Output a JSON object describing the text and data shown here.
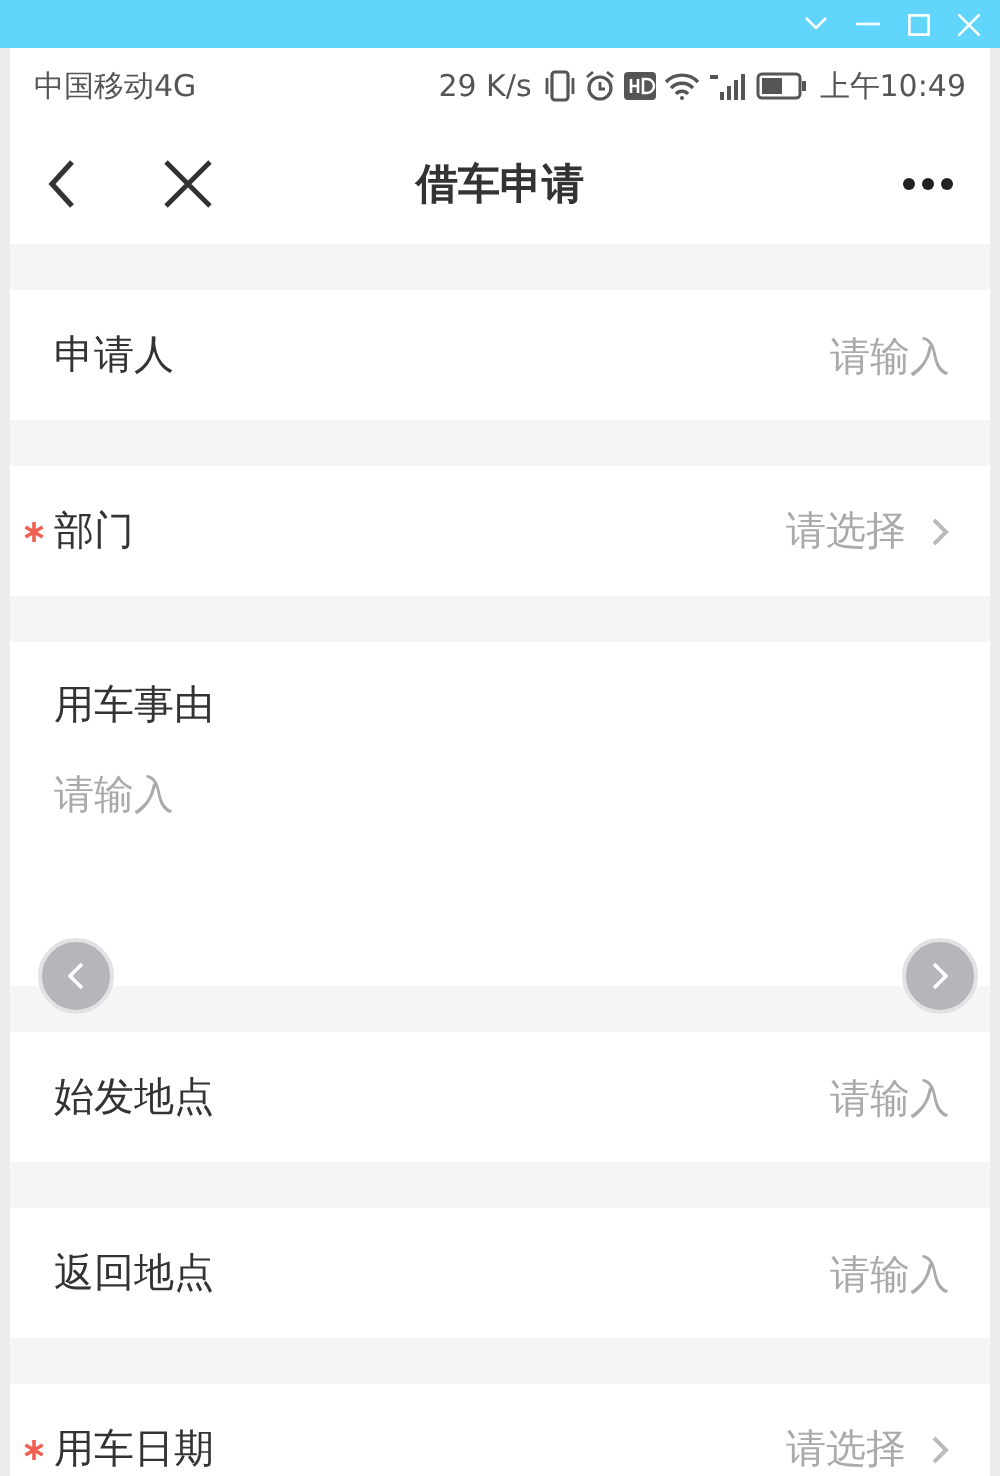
{
  "status_bar": {
    "carrier": "中国移动4G",
    "speed": "29 K/s",
    "time": "上午10:49"
  },
  "nav": {
    "title": "借车申请"
  },
  "fields": [
    {
      "kind": "input",
      "label": "申请人",
      "required": false,
      "placeholder": "请输入"
    },
    {
      "kind": "select",
      "label": "部门",
      "required": true,
      "placeholder": "请选择"
    },
    {
      "kind": "textarea",
      "label": "用车事由",
      "required": false,
      "placeholder": "请输入"
    },
    {
      "kind": "input",
      "label": "始发地点",
      "required": false,
      "placeholder": "请输入"
    },
    {
      "kind": "input",
      "label": "返回地点",
      "required": false,
      "placeholder": "请输入"
    },
    {
      "kind": "select",
      "label": "用车日期",
      "required": true,
      "placeholder": "请选择"
    }
  ]
}
